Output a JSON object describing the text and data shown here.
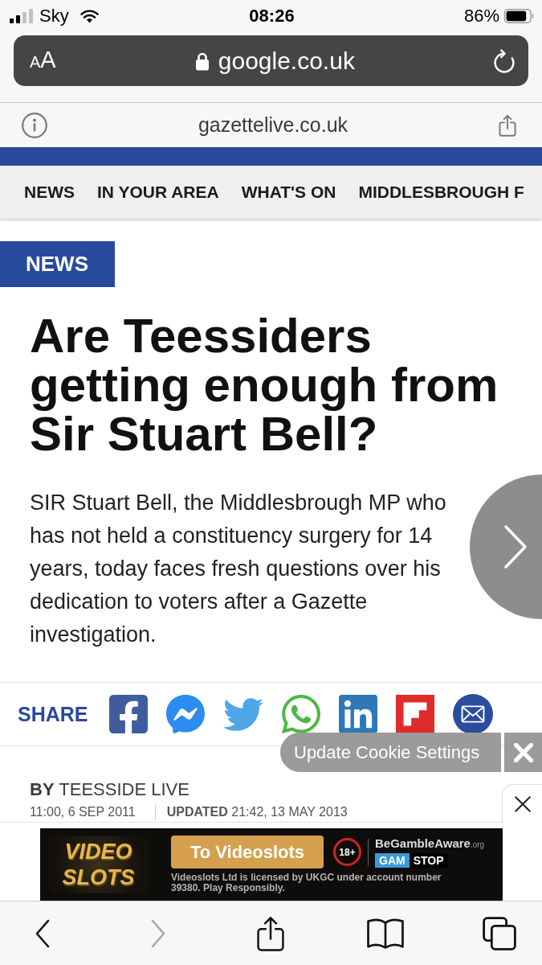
{
  "status_bar": {
    "carrier": "Sky",
    "time": "08:26",
    "battery": "86%"
  },
  "address_bar": {
    "reader_button": "AA",
    "url": "google.co.uk"
  },
  "site_bar": {
    "domain": "gazettelive.co.uk"
  },
  "nav": {
    "items": [
      {
        "label": "NEWS"
      },
      {
        "label": "IN YOUR AREA"
      },
      {
        "label": "WHAT'S ON"
      },
      {
        "label": "MIDDLESBROUGH F"
      }
    ]
  },
  "article": {
    "section": "NEWS",
    "headline": "Are Teessiders getting enough from Sir Stuart Bell?",
    "standfirst": "SIR Stuart Bell, the Middlesbrough MP who has not held a constituency surgery for 14 years, today faces fresh questions over his dedication to voters after a Gazette investigation."
  },
  "share": {
    "label": "SHARE"
  },
  "cookie_banner": {
    "label": "Update Cookie Settings"
  },
  "byline": {
    "author": "**BY** TEESSIDE LIVE",
    "published": "11:00, 6 SEP 2011",
    "updated": "**UPDATED** 21:42, 13 MAY 2013"
  },
  "ad": {
    "logo": "VIDEO SLOTS",
    "cta": "To Videoslots",
    "age_rating": "18+",
    "gamble_aware": "BeGambleAware",
    "gamble_aware_suffix": ".org",
    "gamstop": {
      "first": "GAM",
      "second": "STOP"
    },
    "disclaimer": "Videoslots Ltd is licensed by UKGC under account number 39380. Play Responsibly."
  },
  "toolbar": {
    "back": {
      "disabled": false
    },
    "forward": {
      "disabled": true
    }
  }
}
